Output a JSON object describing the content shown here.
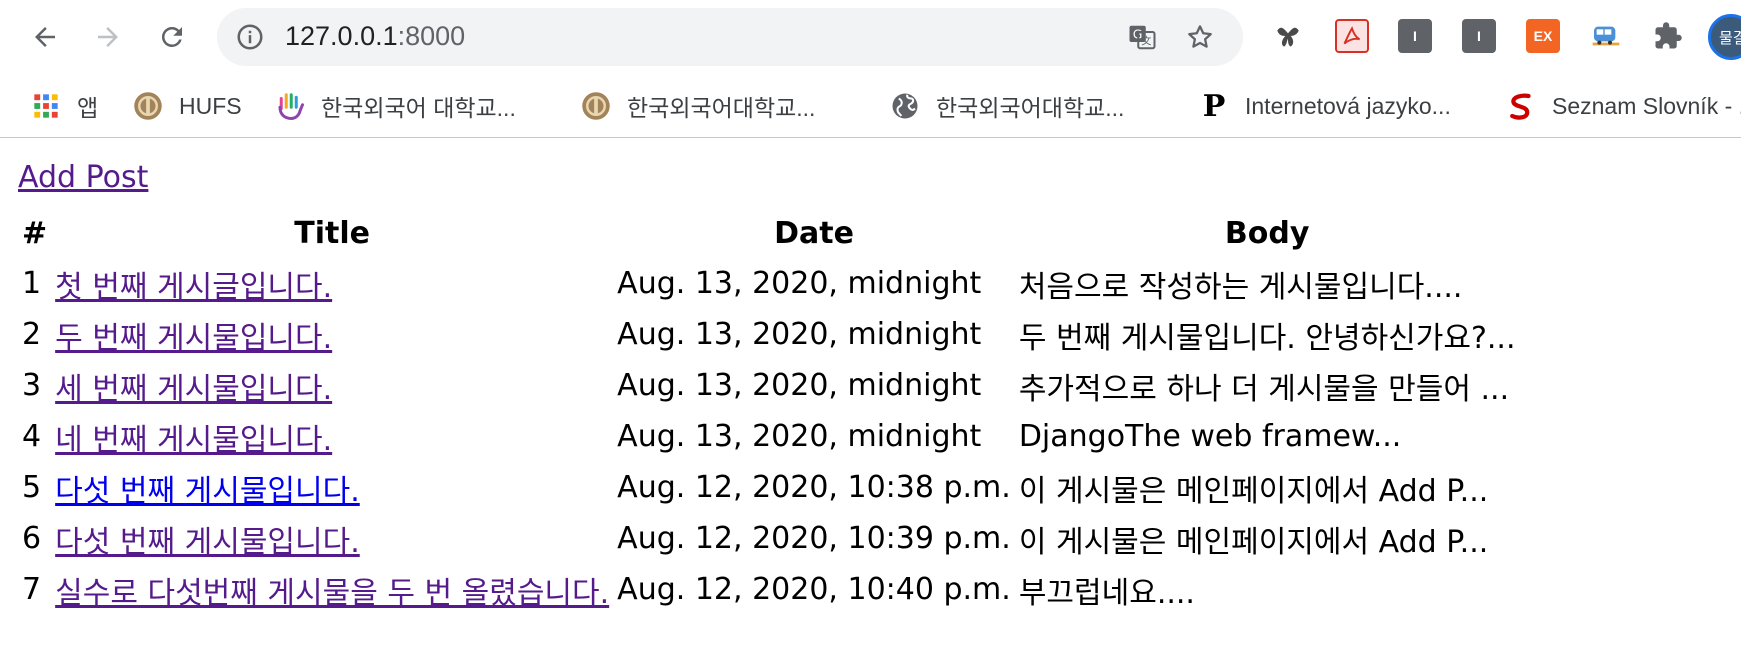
{
  "browser": {
    "url_host": "127.0.0.1",
    "url_port": ":8000",
    "profile_label": "물결",
    "extensions": [
      {
        "name": "extension-1",
        "label": ""
      },
      {
        "name": "pdf-extension",
        "label": ""
      },
      {
        "name": "extension-i-1",
        "label": "I"
      },
      {
        "name": "extension-i-2",
        "label": "I"
      },
      {
        "name": "extension-ex",
        "label": "EX"
      }
    ]
  },
  "bookmarks": [
    {
      "label": "앱",
      "icon": "apps-grid-icon"
    },
    {
      "label": "HUFS",
      "icon": "hufs-logo-icon"
    },
    {
      "label": "한국외국어 대학교...",
      "icon": "hand-logo-icon"
    },
    {
      "label": "한국외국어대학교...",
      "icon": "hufs-logo-icon"
    },
    {
      "label": "한국외국어대학교...",
      "icon": "globe-icon"
    },
    {
      "label": "Internetová jazyko...",
      "icon": "p-logo-icon"
    },
    {
      "label": "Seznam Slovník - ...",
      "icon": "seznam-s-icon"
    }
  ],
  "page": {
    "add_post_label": "Add Post",
    "headers": {
      "num": "#",
      "title": "Title",
      "date": "Date",
      "body": "Body"
    },
    "posts": [
      {
        "num": "1",
        "title": "첫 번째 게시글입니다.",
        "date": "Aug. 13, 2020, midnight",
        "body": "처음으로 작성하는 게시물입니다...."
      },
      {
        "num": "2",
        "title": "두 번째 게시물입니다.",
        "date": "Aug. 13, 2020, midnight",
        "body": "두 번째 게시물입니다. 안녕하신가요?..."
      },
      {
        "num": "3",
        "title": "세 번째 게시물입니다.",
        "date": "Aug. 13, 2020, midnight",
        "body": "추가적으로 하나 더 게시물을 만들어 ..."
      },
      {
        "num": "4",
        "title": "네 번째 게시물입니다.",
        "date": "Aug. 13, 2020, midnight",
        "body": "DjangoThe web framew..."
      },
      {
        "num": "5",
        "title": "다섯 번째 게시물입니다.",
        "date": "Aug. 12, 2020, 10:38 p.m.",
        "body": "이 게시물은 메인페이지에서 Add P..."
      },
      {
        "num": "6",
        "title": "다섯 번째 게시물입니다.",
        "date": "Aug. 12, 2020, 10:39 p.m.",
        "body": "이 게시물은 메인페이지에서 Add P..."
      },
      {
        "num": "7",
        "title": "실수로 다섯번째 게시물을 두 번 올렸습니다.",
        "date": "Aug. 12, 2020, 10:40 p.m.",
        "body": "부끄럽네요...."
      }
    ]
  },
  "colors": {
    "visited_link": "#551a8b",
    "unvisited_link": "#0000ee",
    "omnibox_bg": "#f1f3f4"
  }
}
